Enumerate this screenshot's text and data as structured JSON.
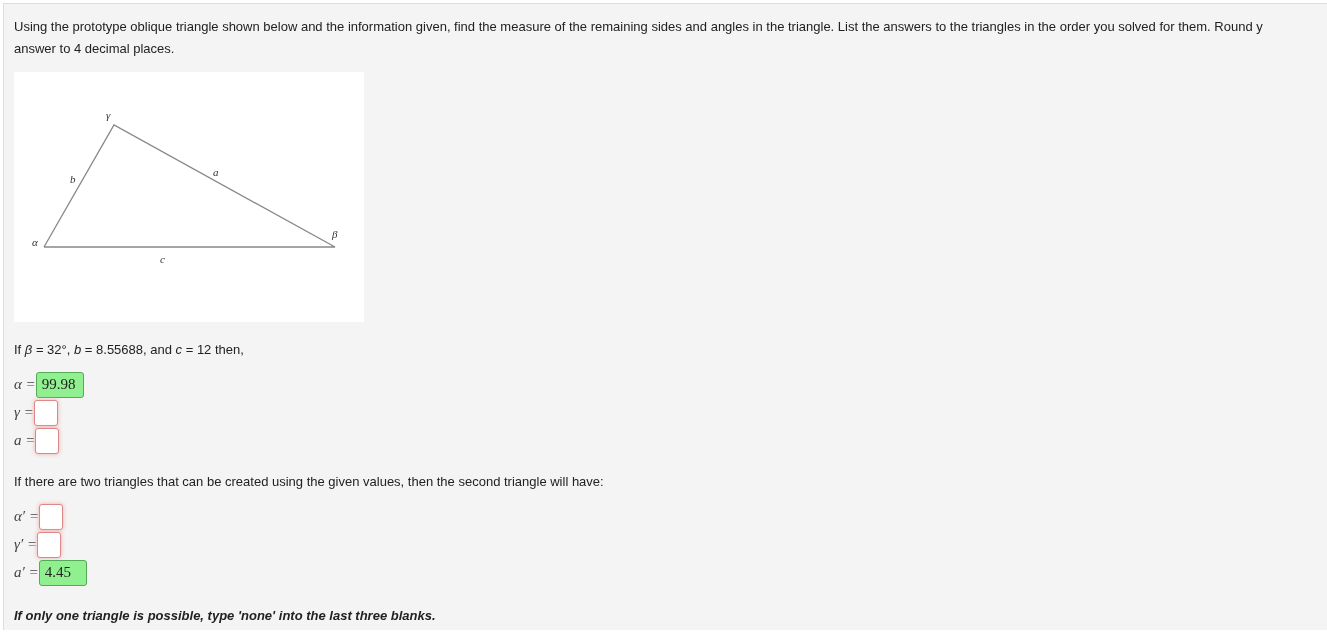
{
  "intro_lines": [
    "Using the prototype oblique triangle shown below and the information given, find the measure of the remaining sides and angles in the triangle. List the answers to the triangles in the order you solved for them. Round y",
    "answer to 4 decimal places."
  ],
  "figure": {
    "vertex_labels": [
      "α",
      "γ",
      "β"
    ],
    "side_labels": [
      "b",
      "a",
      "c"
    ]
  },
  "condition": "If *β* = 32°, *b* = 8.55688, and *c* = 12 then,",
  "first_triangle": [
    {
      "label": "α =",
      "value": "99.98",
      "correct": true
    },
    {
      "label": "γ =",
      "correct": false
    },
    {
      "label": "a =",
      "correct": false
    }
  ],
  "second_intro": "If there are two triangles that can be created using the given values, then the second triangle will have:",
  "second_triangle": [
    {
      "label": "α′ =",
      "correct": false
    },
    {
      "label": "γ′ =",
      "correct": false
    },
    {
      "label": "a′ =",
      "value": "4.45",
      "correct": true
    }
  ],
  "note": "If only one triangle is possible, type 'none' into the last three blanks."
}
